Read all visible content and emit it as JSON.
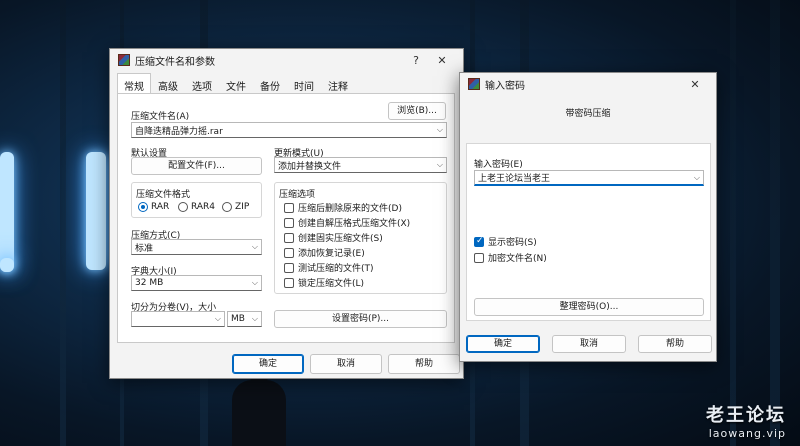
{
  "watermark": {
    "site_cn": "老王论坛",
    "site_en": "laowang.vip"
  },
  "compress_dialog": {
    "title": "压缩文件名和参数",
    "help_glyph": "?",
    "close_glyph": "✕",
    "tabs": [
      "常规",
      "高级",
      "选项",
      "文件",
      "备份",
      "时间",
      "注释"
    ],
    "archive_name_label": "压缩文件名(A)",
    "browse_label": "浏览(B)...",
    "archive_name_value": "自降迭精品弹力摇.rar",
    "default_settings_label": "默认设置",
    "profiles_label": "配置文件(F)...",
    "update_mode_label": "更新模式(U)",
    "update_mode_value": "添加并替换文件",
    "format_label": "压缩文件格式",
    "formats": {
      "rar": "RAR",
      "rar4": "RAR4",
      "zip": "ZIP"
    },
    "selected_format": "RAR",
    "options_label": "压缩选项",
    "options": [
      {
        "label": "压缩后删除原来的文件(D)",
        "checked": false
      },
      {
        "label": "创建自解压格式压缩文件(X)",
        "checked": false
      },
      {
        "label": "创建固实压缩文件(S)",
        "checked": false
      },
      {
        "label": "添加恢复记录(E)",
        "checked": false
      },
      {
        "label": "测试压缩的文件(T)",
        "checked": false
      },
      {
        "label": "锁定压缩文件(L)",
        "checked": false
      }
    ],
    "method_label": "压缩方式(C)",
    "method_value": "标准",
    "dict_label": "字典大小(I)",
    "dict_value": "32 MB",
    "split_label": "切分为分卷(V)，大小",
    "split_value": "",
    "split_unit": "MB",
    "set_password_label": "设置密码(P)...",
    "ok_label": "确定",
    "cancel_label": "取消",
    "help_label": "帮助"
  },
  "password_dialog": {
    "title": "输入密码",
    "close_glyph": "✕",
    "heading": "带密码压缩",
    "enter_label": "输入密码(E)",
    "password_value": "上老王论坛当老王",
    "show_password_label": "显示密码(S)",
    "show_password_checked": true,
    "encrypt_names_label": "加密文件名(N)",
    "encrypt_names_checked": false,
    "organize_label": "整理密码(O)...",
    "ok_label": "确定",
    "cancel_label": "取消",
    "help_label": "帮助"
  },
  "colors": {
    "accent": "#0067c0",
    "dialog_bg": "#f3f3f3"
  }
}
